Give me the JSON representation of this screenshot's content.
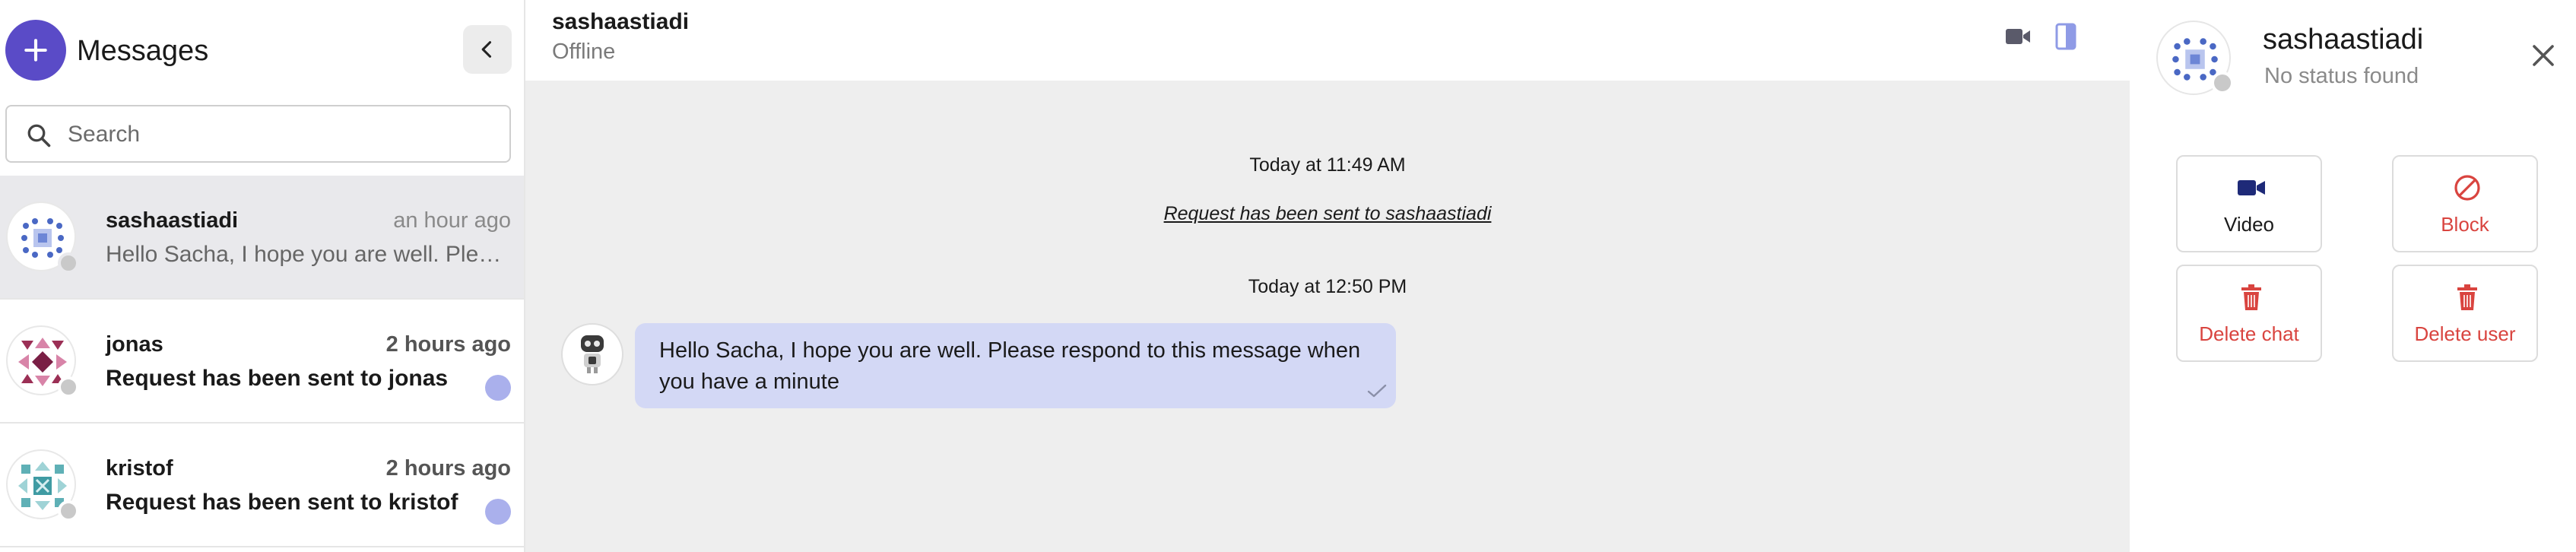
{
  "sidebar": {
    "title": "Messages",
    "new_button_icon": "plus-icon",
    "collapse_icon": "chevron-left-icon",
    "search": {
      "placeholder": "Search",
      "value": ""
    },
    "conversations": [
      {
        "name": "sashaastiadi",
        "time": "an hour ago",
        "preview": "Hello Sacha, I hope you are well. Please respond to this message when you have a minute",
        "active": true,
        "unread": false
      },
      {
        "name": "jonas",
        "time": "2 hours ago",
        "preview": "Request has been sent to jonas",
        "active": false,
        "unread": true
      },
      {
        "name": "kristof",
        "time": "2 hours ago",
        "preview": "Request has been sent to kristof",
        "active": false,
        "unread": true
      }
    ]
  },
  "chat": {
    "contact_name": "sashaastiadi",
    "contact_status": "Offline",
    "header_icons": [
      "video-camera-icon",
      "side-panel-icon"
    ],
    "messages": [
      {
        "kind": "timestamp",
        "text": "Today at 11:49 AM"
      },
      {
        "kind": "system",
        "text": "Request has been sent to sashaastiadi"
      },
      {
        "kind": "timestamp",
        "text": "Today at 12:50 PM"
      },
      {
        "kind": "message",
        "text": "Hello Sacha, I hope you are well. Please respond to this message when you have a minute",
        "status": "sent"
      }
    ]
  },
  "details": {
    "name": "sashaastiadi",
    "status": "No status found",
    "close_icon": "close-icon",
    "actions": [
      {
        "label": "Video",
        "icon": "video-camera-icon",
        "color": "#1a1a1a"
      },
      {
        "label": "Block",
        "icon": "block-icon",
        "color": "#d9443f"
      },
      {
        "label": "Delete chat",
        "icon": "trash-icon",
        "color": "#d9443f"
      },
      {
        "label": "Delete user",
        "icon": "trash-icon",
        "color": "#d9443f"
      }
    ]
  },
  "colors": {
    "accent": "#5a4bc7",
    "bubble": "#d3d8f5",
    "unread_dot": "#aab0ec",
    "danger": "#d9443f",
    "offline": "#c9c9c9"
  }
}
